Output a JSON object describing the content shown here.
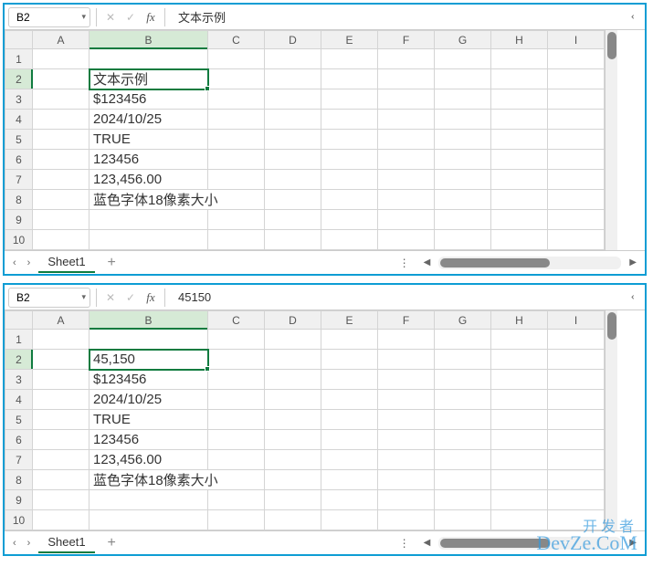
{
  "pane1": {
    "namebox": "B2",
    "formula": "文本示例",
    "columns": [
      "A",
      "B",
      "C",
      "D",
      "E",
      "F",
      "G",
      "H",
      "I"
    ],
    "rows": [
      "1",
      "2",
      "3",
      "4",
      "5",
      "6",
      "7",
      "8",
      "9",
      "10"
    ],
    "cells": {
      "B2": "文本示例",
      "B3": "$123456",
      "B4": "2024/10/25",
      "B5": "TRUE",
      "B6": "123456",
      "B7": "123,456.00",
      "B8": "蓝色字体18像素大小"
    },
    "sheet_tab": "Sheet1",
    "add_tab": "+"
  },
  "pane2": {
    "namebox": "B2",
    "formula": "45150",
    "columns": [
      "A",
      "B",
      "C",
      "D",
      "E",
      "F",
      "G",
      "H",
      "I"
    ],
    "rows": [
      "1",
      "2",
      "3",
      "4",
      "5",
      "6",
      "7",
      "8",
      "9",
      "10"
    ],
    "cells": {
      "B2": "45,150",
      "B3": "$123456",
      "B4": "2024/10/25",
      "B5": "TRUE",
      "B6": "123456",
      "B7": "123,456.00",
      "B8": "蓝色字体18像素大小"
    },
    "sheet_tab": "Sheet1",
    "add_tab": "+"
  },
  "watermark": {
    "line1": "开发者",
    "line2": "DevZe.CoM"
  },
  "chart_data": {
    "type": "table",
    "description": "Two spreadsheet panes showing cell values in column B",
    "pane_top": {
      "active_cell": "B2",
      "formula_bar_value": "文本示例",
      "rows": [
        {
          "row": 2,
          "B": "文本示例",
          "style": "selected, default black"
        },
        {
          "row": 3,
          "B": "$123456"
        },
        {
          "row": 4,
          "B": "2024/10/25"
        },
        {
          "row": 5,
          "B": "TRUE"
        },
        {
          "row": 6,
          "B": "123456"
        },
        {
          "row": 7,
          "B": "123,456.00"
        },
        {
          "row": 8,
          "B": "蓝色字体18像素大小",
          "style": "blue 18px"
        }
      ]
    },
    "pane_bottom": {
      "active_cell": "B2",
      "formula_bar_value": "45150",
      "rows": [
        {
          "row": 2,
          "B": "45,150",
          "style": "selected, green text"
        },
        {
          "row": 3,
          "B": "$123456"
        },
        {
          "row": 4,
          "B": "2024/10/25"
        },
        {
          "row": 5,
          "B": "TRUE"
        },
        {
          "row": 6,
          "B": "123456"
        },
        {
          "row": 7,
          "B": "123,456.00"
        },
        {
          "row": 8,
          "B": "蓝色字体18像素大小",
          "style": "blue 18px"
        }
      ]
    }
  }
}
